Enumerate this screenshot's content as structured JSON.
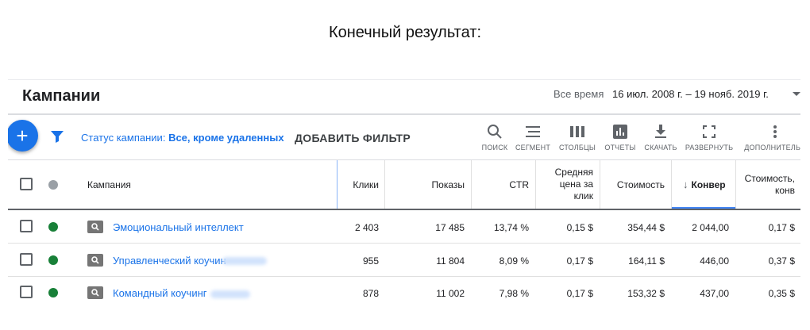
{
  "caption": "Конечный результат:",
  "header": {
    "title": "Кампании",
    "date_range_label": "Все время",
    "date_range_value": "16 июл. 2008 г. – 19 нояб. 2019 г."
  },
  "filter_bar": {
    "status_label": "Статус кампании:",
    "status_value": "Все, кроме удаленных",
    "add_filter_label": "ДОБАВИТЬ ФИЛЬТР"
  },
  "toolbar": {
    "search": "ПОИСК",
    "segment": "СЕГМЕНТ",
    "columns": "СТОЛБЦЫ",
    "reports": "ОТЧЕТЫ",
    "download": "СКАЧАТЬ",
    "expand": "РАЗВЕРНУТЬ",
    "more": "ДОПОЛНИТЕЛЬН"
  },
  "table": {
    "columns": {
      "campaign": "Кампания",
      "clicks": "Клики",
      "impressions": "Показы",
      "ctr": "CTR",
      "avg_cpc_line1": "Средняя",
      "avg_cpc_line2": "цена за",
      "avg_cpc_line3": "клик",
      "cost": "Стоимость",
      "conversions": "Конвер",
      "cost_per_conv_line1": "Стоимость,",
      "cost_per_conv_line2": "конв"
    },
    "rows": [
      {
        "name": "Эмоциональный интеллект",
        "clicks": "2 403",
        "impressions": "17 485",
        "ctr": "13,74 %",
        "avg_cpc": "0,15 $",
        "cost": "354,44 $",
        "conversions": "2 044,00",
        "cost_per_conv": "0,17 $"
      },
      {
        "name": "Управленческий коучин",
        "clicks": "955",
        "impressions": "11 804",
        "ctr": "8,09 %",
        "avg_cpc": "0,17 $",
        "cost": "164,11 $",
        "conversions": "446,00",
        "cost_per_conv": "0,37 $"
      },
      {
        "name": "Командный коучинг",
        "clicks": "878",
        "impressions": "11 002",
        "ctr": "7,98 %",
        "avg_cpc": "0,17 $",
        "cost": "153,32 $",
        "conversions": "437,00",
        "cost_per_conv": "0,35 $"
      }
    ]
  },
  "colors": {
    "accent": "#1a73e8",
    "status_enabled": "#188038",
    "status_header": "#9aa0a6"
  },
  "icons": {
    "add": "plus-icon",
    "filter": "filter-icon",
    "search": "search-icon",
    "segment": "segment-icon",
    "columns": "columns-icon",
    "reports": "reports-icon",
    "download": "download-icon",
    "expand": "expand-icon",
    "more": "more-vert-icon",
    "campaign_type": "search-campaign-icon",
    "sort": "arrow-down-icon",
    "date_range": "caret-down-icon"
  }
}
